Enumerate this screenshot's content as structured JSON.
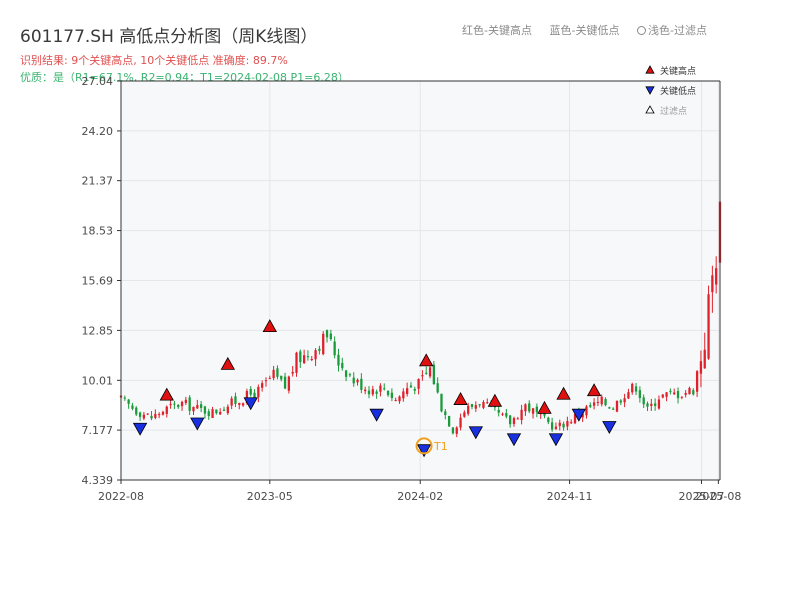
{
  "header": {
    "title": "601177.SH 高低点分析图（周K线图）",
    "result_line": "识别结果: 9个关键高点, 10个关键低点  准确度: 89.7%",
    "quality_line": "优质：是（R1=67.1%, R2=0.94；T1=2024-02-08 P1=6.28）",
    "hint": {
      "red": "红色-关键高点",
      "blue": "蓝色-关键低点",
      "light": "浅色-过滤点"
    }
  },
  "colors": {
    "up": "#e0202a",
    "down": "#1a9a3a",
    "high_marker": "#e01010",
    "low_marker": "#1830e0",
    "t1_circle": "#f0a020",
    "plot_bg": "#f7f8fa",
    "grid": "#e4e6ea"
  },
  "chart_data": {
    "type": "candlestick",
    "title": "601177.SH 高低点分析图（周K线图）",
    "y_ticks": [
      "4.339",
      "7.177",
      "10.01",
      "12.85",
      "15.69",
      "18.53",
      "21.37",
      "24.20",
      "27.04"
    ],
    "ylim": [
      4.339,
      27.04
    ],
    "x_ticks": [
      {
        "label": "2022-08",
        "date": "2022-08-01"
      },
      {
        "label": "2023-05",
        "date": "2023-05-01"
      },
      {
        "label": "2024-02",
        "date": "2024-02-01"
      },
      {
        "label": "2024-11",
        "date": "2024-11-01"
      },
      {
        "label": "2025-07",
        "date": "2025-07-01"
      },
      {
        "label": "2025-08",
        "date": "2025-08-01"
      }
    ],
    "xlim": [
      "2022-08-01",
      "2025-08-04"
    ],
    "grid": true,
    "close_points": [
      [
        "2022-08-01",
        8.9
      ],
      [
        "2022-08-29",
        8.3
      ],
      [
        "2022-09-26",
        7.9
      ],
      [
        "2022-10-24",
        8.4
      ],
      [
        "2022-11-21",
        8.7
      ],
      [
        "2022-12-19",
        8.4
      ],
      [
        "2023-01-16",
        8.2
      ],
      [
        "2023-02-13",
        8.6
      ],
      [
        "2023-03-13",
        9.0
      ],
      [
        "2023-04-10",
        9.4
      ],
      [
        "2023-05-08",
        10.3
      ],
      [
        "2023-05-29",
        9.6
      ],
      [
        "2023-06-19",
        11.2
      ],
      [
        "2023-07-17",
        11.6
      ],
      [
        "2023-08-14",
        12.6
      ],
      [
        "2023-09-04",
        11.1
      ],
      [
        "2023-10-02",
        10.0
      ],
      [
        "2023-10-30",
        9.5
      ],
      [
        "2023-11-27",
        9.6
      ],
      [
        "2023-12-18",
        8.9
      ],
      [
        "2024-01-08",
        9.6
      ],
      [
        "2024-01-29",
        9.8
      ],
      [
        "2024-02-19",
        10.7
      ],
      [
        "2024-03-11",
        8.5
      ],
      [
        "2024-04-01",
        7.2
      ],
      [
        "2024-04-22",
        8.3
      ],
      [
        "2024-05-20",
        8.8
      ],
      [
        "2024-06-17",
        8.2
      ],
      [
        "2024-07-15",
        7.6
      ],
      [
        "2024-08-12",
        8.6
      ],
      [
        "2024-09-09",
        7.9
      ],
      [
        "2024-10-07",
        7.3
      ],
      [
        "2024-11-04",
        7.8
      ],
      [
        "2024-12-02",
        8.4
      ],
      [
        "2024-12-30",
        8.8
      ],
      [
        "2025-01-20",
        8.5
      ],
      [
        "2025-02-10",
        9.3
      ],
      [
        "2025-03-03",
        9.7
      ],
      [
        "2025-03-24",
        8.3
      ],
      [
        "2025-04-14",
        9.1
      ],
      [
        "2025-05-05",
        9.2
      ],
      [
        "2025-05-26",
        9.3
      ],
      [
        "2025-06-16",
        9.5
      ],
      [
        "2025-07-07",
        12.5
      ],
      [
        "2025-08-04",
        19.3
      ]
    ],
    "key_highs": [
      {
        "date": "2022-10-24",
        "price": 8.95
      },
      {
        "date": "2023-02-13",
        "price": 10.7
      },
      {
        "date": "2023-05-01",
        "price": 12.85
      },
      {
        "date": "2024-02-12",
        "price": 10.9
      },
      {
        "date": "2024-04-15",
        "price": 8.7
      },
      {
        "date": "2024-06-17",
        "price": 8.6
      },
      {
        "date": "2024-09-16",
        "price": 8.2
      },
      {
        "date": "2024-10-21",
        "price": 9.0
      },
      {
        "date": "2024-12-16",
        "price": 9.2
      }
    ],
    "key_lows": [
      {
        "date": "2022-09-05",
        "price": 7.5
      },
      {
        "date": "2022-12-19",
        "price": 7.8
      },
      {
        "date": "2023-03-27",
        "price": 8.95
      },
      {
        "date": "2023-11-13",
        "price": 8.3
      },
      {
        "date": "2024-02-08",
        "price": 6.28
      },
      {
        "date": "2024-05-13",
        "price": 7.3
      },
      {
        "date": "2024-07-22",
        "price": 6.9
      },
      {
        "date": "2024-10-07",
        "price": 6.9
      },
      {
        "date": "2024-11-18",
        "price": 8.3
      },
      {
        "date": "2025-01-13",
        "price": 7.6
      }
    ],
    "t1": {
      "date": "2024-02-08",
      "price": 6.28,
      "label": "T1"
    },
    "legend": {
      "placement": "top-right",
      "items": [
        {
          "key": "high",
          "label": "关键高点"
        },
        {
          "key": "low",
          "label": "关键低点"
        },
        {
          "key": "filtered",
          "label": "过滤点"
        }
      ]
    }
  }
}
